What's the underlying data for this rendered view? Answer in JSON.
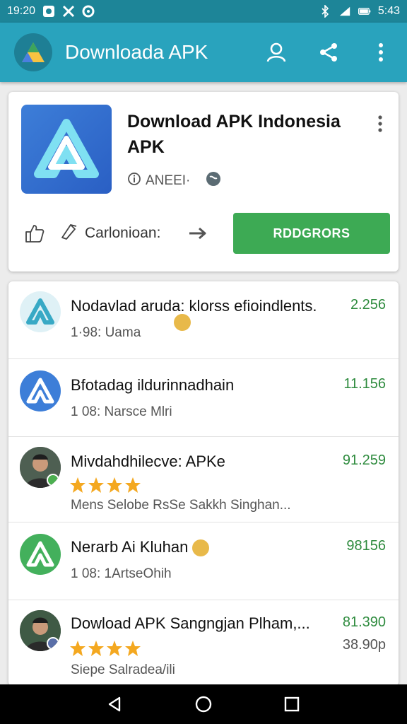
{
  "status_bar": {
    "time": "19:20",
    "clock": "5:43"
  },
  "app_bar": {
    "title": "Downloada APK"
  },
  "hero": {
    "title": "Download APK Indonesia APK",
    "meta": "ANEEI·",
    "category": "Carlonioan:",
    "download_label": "RDDGRORS"
  },
  "list": [
    {
      "title": "Nodavlad aruda: klorss efioindlents.",
      "sub": "1·98: Uama",
      "count": "2.256",
      "avatar_color": "#dff1f6"
    },
    {
      "title": "Bfotadag ildurinnadhain",
      "sub": "1 08: Narsce Mlri",
      "count": "11.156",
      "avatar_color": "#3d7ed8"
    },
    {
      "title": "Mivdahdhilecve: APKe",
      "sub": "Mens Selobe RsSe Sakkh Singhan...",
      "count": "91.259",
      "rating": 4,
      "avatar_color": "#6b6b6b"
    },
    {
      "title": "Nerarb Ai Kluhan",
      "sub": "1 08: 1ArtseOhih",
      "count": "98156",
      "avatar_color": "#43b05c"
    },
    {
      "title": "Dowload APK Sangngjan Plham,...",
      "sub": "Siepe Salradea/ili",
      "count": "81.390",
      "count2": "38.90p",
      "rating": 4,
      "avatar_color": "#5a5a5a"
    }
  ],
  "colors": {
    "primary": "#29a3bd",
    "status": "#1d8598",
    "accent_green": "#3daa54",
    "star": "#f4a820"
  }
}
